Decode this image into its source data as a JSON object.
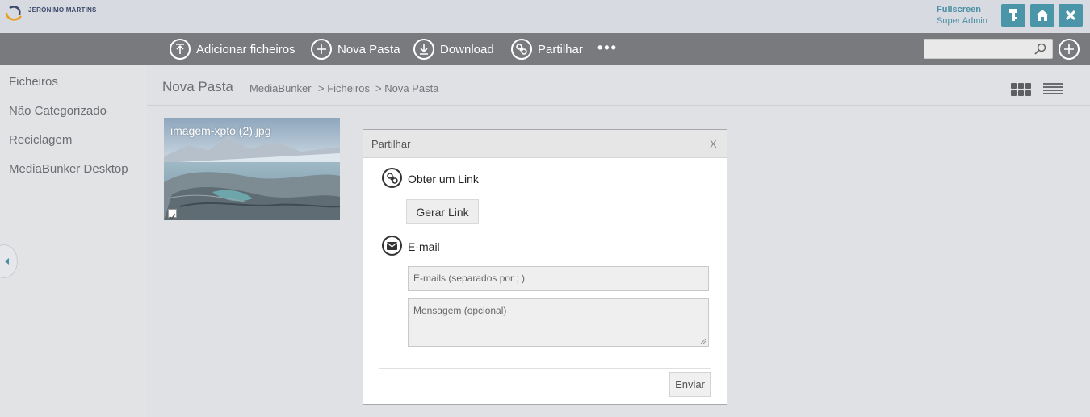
{
  "header": {
    "logo_text": "JERÓNIMO MARTINS",
    "mode": "Fullscreen",
    "role": "Super Admin",
    "buttons": [
      "key-icon",
      "home-icon",
      "close-icon"
    ],
    "accent": "#4a95a8"
  },
  "toolbar": {
    "add_files": "Adicionar ficheiros",
    "new_folder": "Nova Pasta",
    "download": "Download",
    "share": "Partilhar",
    "more": "•••",
    "search_placeholder": ""
  },
  "sidebar": {
    "items": [
      {
        "label": "Ficheiros"
      },
      {
        "label": "Não Categorizado"
      },
      {
        "label": "Reciclagem"
      },
      {
        "label": "MediaBunker Desktop"
      }
    ]
  },
  "main": {
    "title": "Nova Pasta",
    "breadcrumb": [
      "MediaBunker",
      "> Ficheiros",
      "> Nova Pasta"
    ],
    "file": {
      "name": "imagem-xpto (2).jpg",
      "selected": true
    }
  },
  "modal": {
    "title": "Partilhar",
    "close": "X",
    "link_section": "Obter um Link",
    "generate_link": "Gerar Link",
    "email_section": "E-mail",
    "emails_placeholder": "E-mails (separados por ; )",
    "message_placeholder": "Mensagem (opcional)",
    "send": "Enviar"
  }
}
